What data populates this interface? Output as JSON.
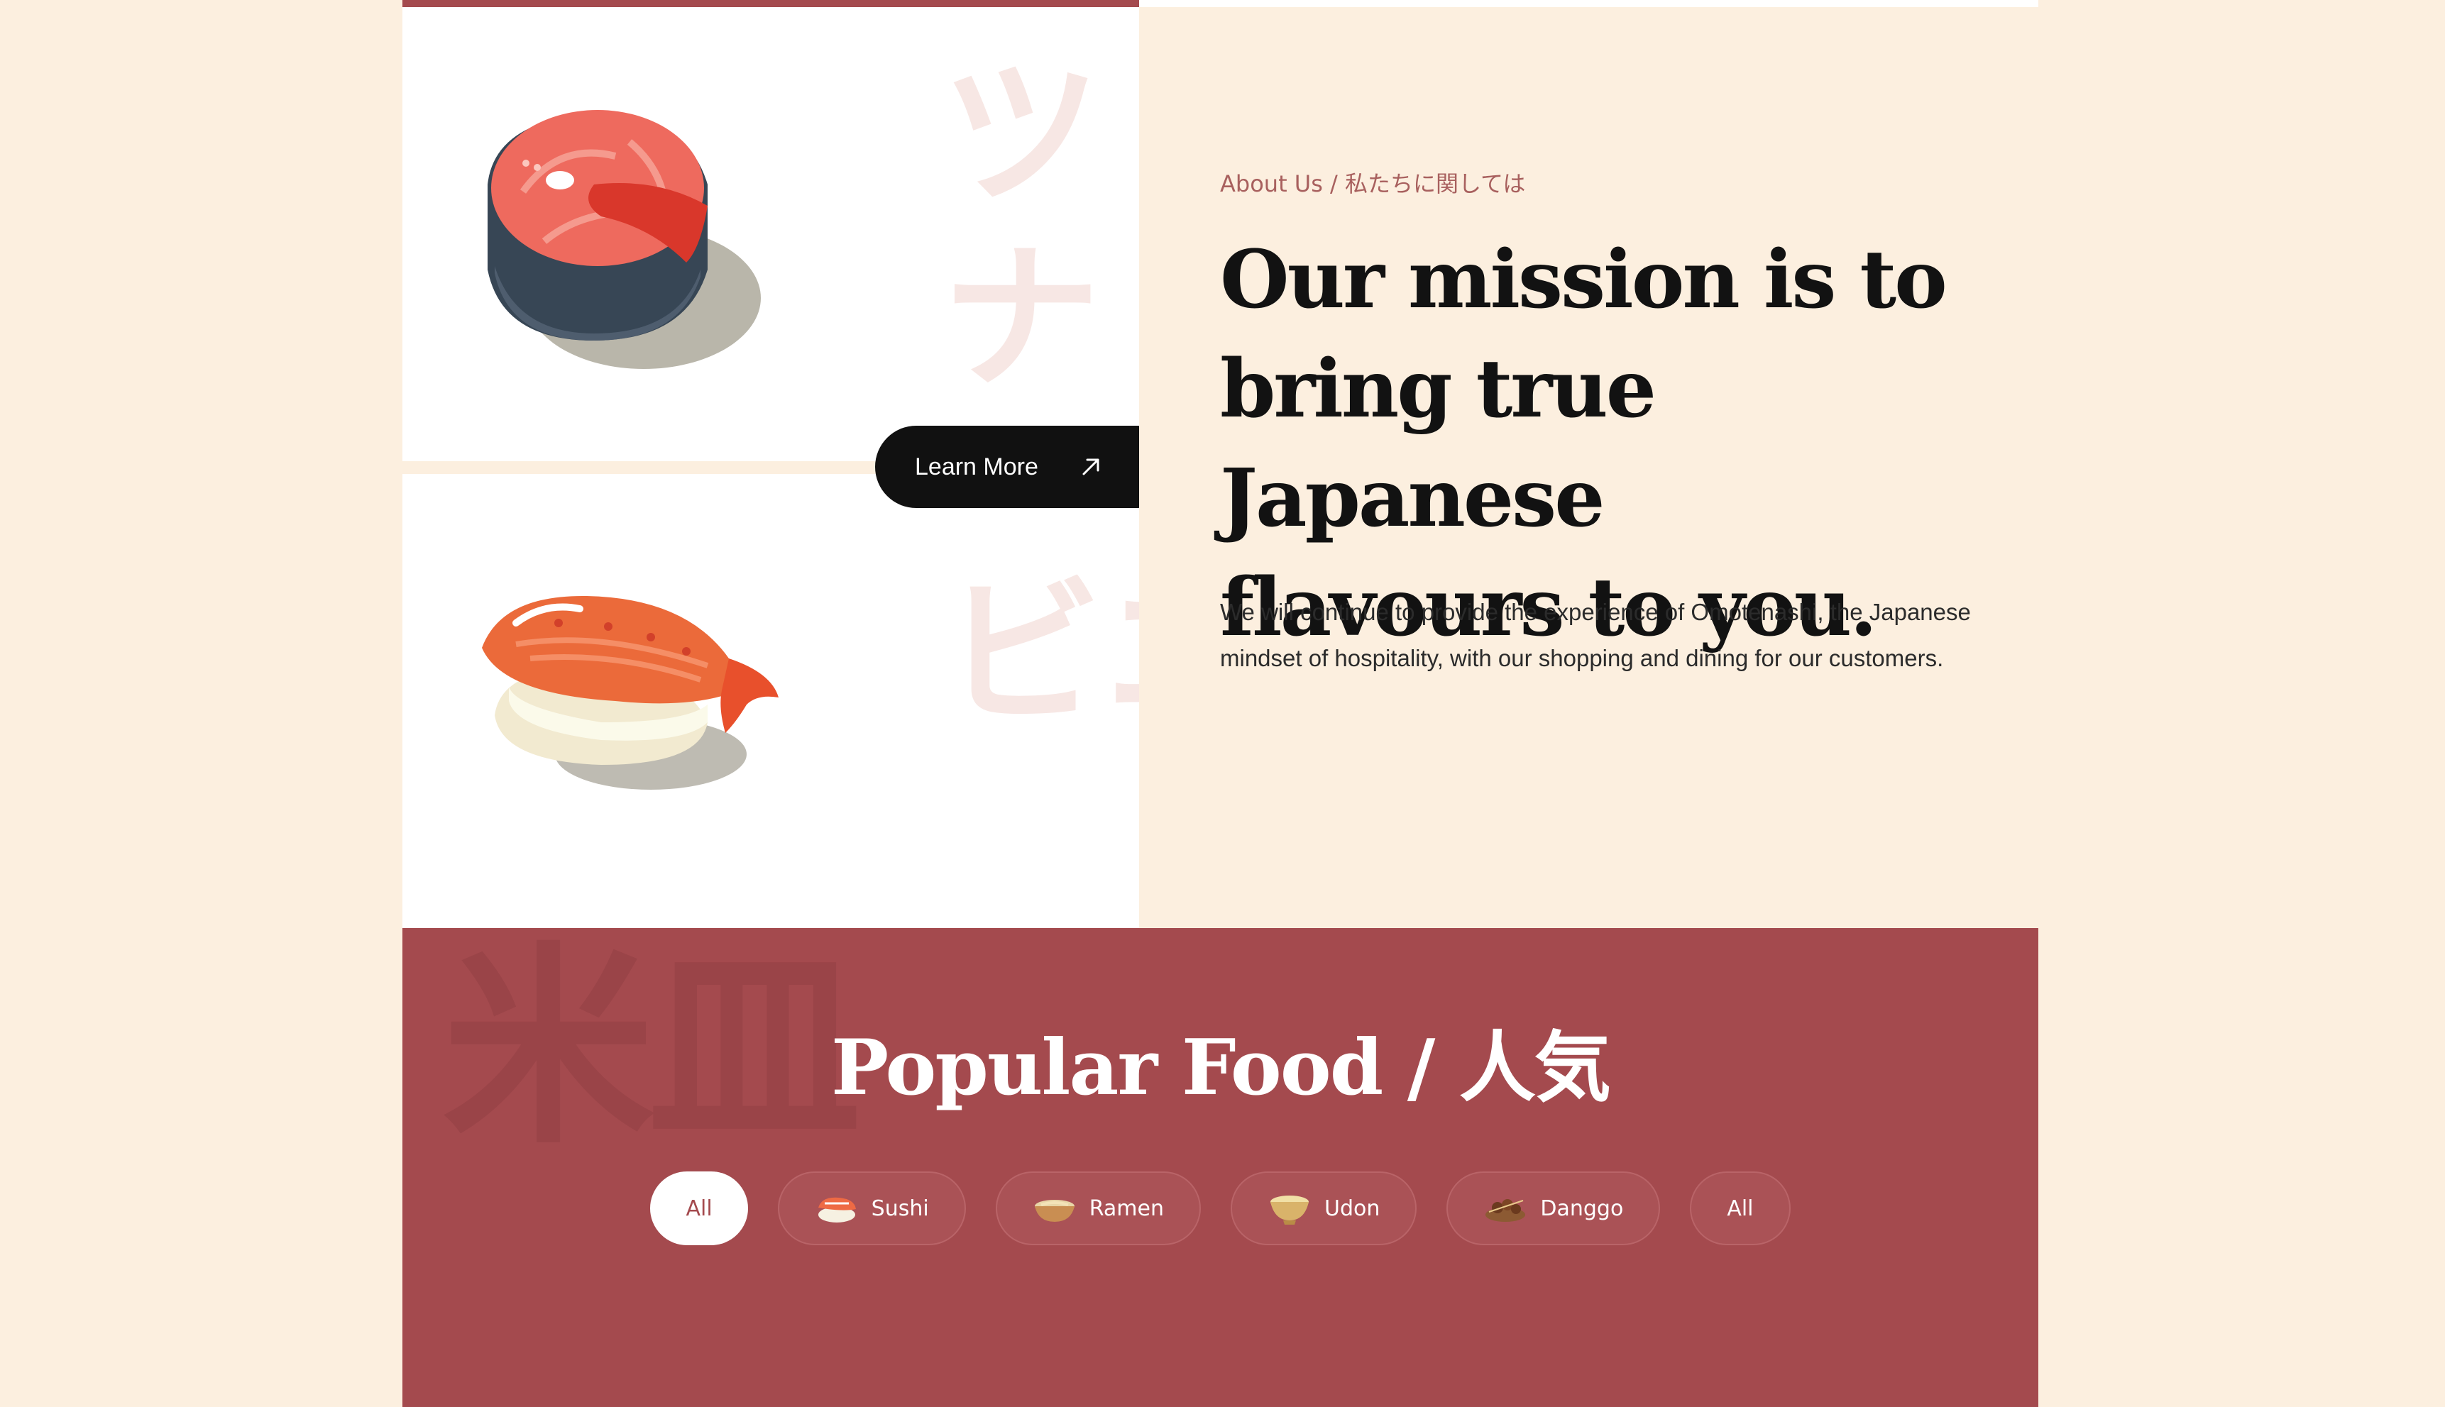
{
  "about": {
    "crumb": "About Us / 私たちに関しては",
    "headline_lines": [
      "Our mission is to",
      "bring true Japanese",
      "flavours to you."
    ],
    "description": "We will continue to provide the experience of Omotenashi, the Japanese mindset of hospitality, with our shopping and dining for our customers.",
    "learn_more": "Learn More"
  },
  "panels": {
    "tuna_kanji": "ツナ",
    "ebi_kanji": "エビ"
  },
  "popular": {
    "title": "Popular Food / 人気",
    "bg_kanji": "米皿",
    "filters": [
      {
        "label": "All",
        "icon": "none",
        "active": true
      },
      {
        "label": "Sushi",
        "icon": "sushi-icon"
      },
      {
        "label": "Ramen",
        "icon": "ramen-bowl-icon"
      },
      {
        "label": "Udon",
        "icon": "udon-bowl-icon"
      },
      {
        "label": "Danggo",
        "icon": "danggo-icon"
      },
      {
        "label": "All",
        "icon": "none"
      }
    ]
  },
  "colors": {
    "accent": "#A44A4E",
    "cream": "#FCEFDF",
    "dark": "#111111",
    "crumb": "#A8605E"
  }
}
